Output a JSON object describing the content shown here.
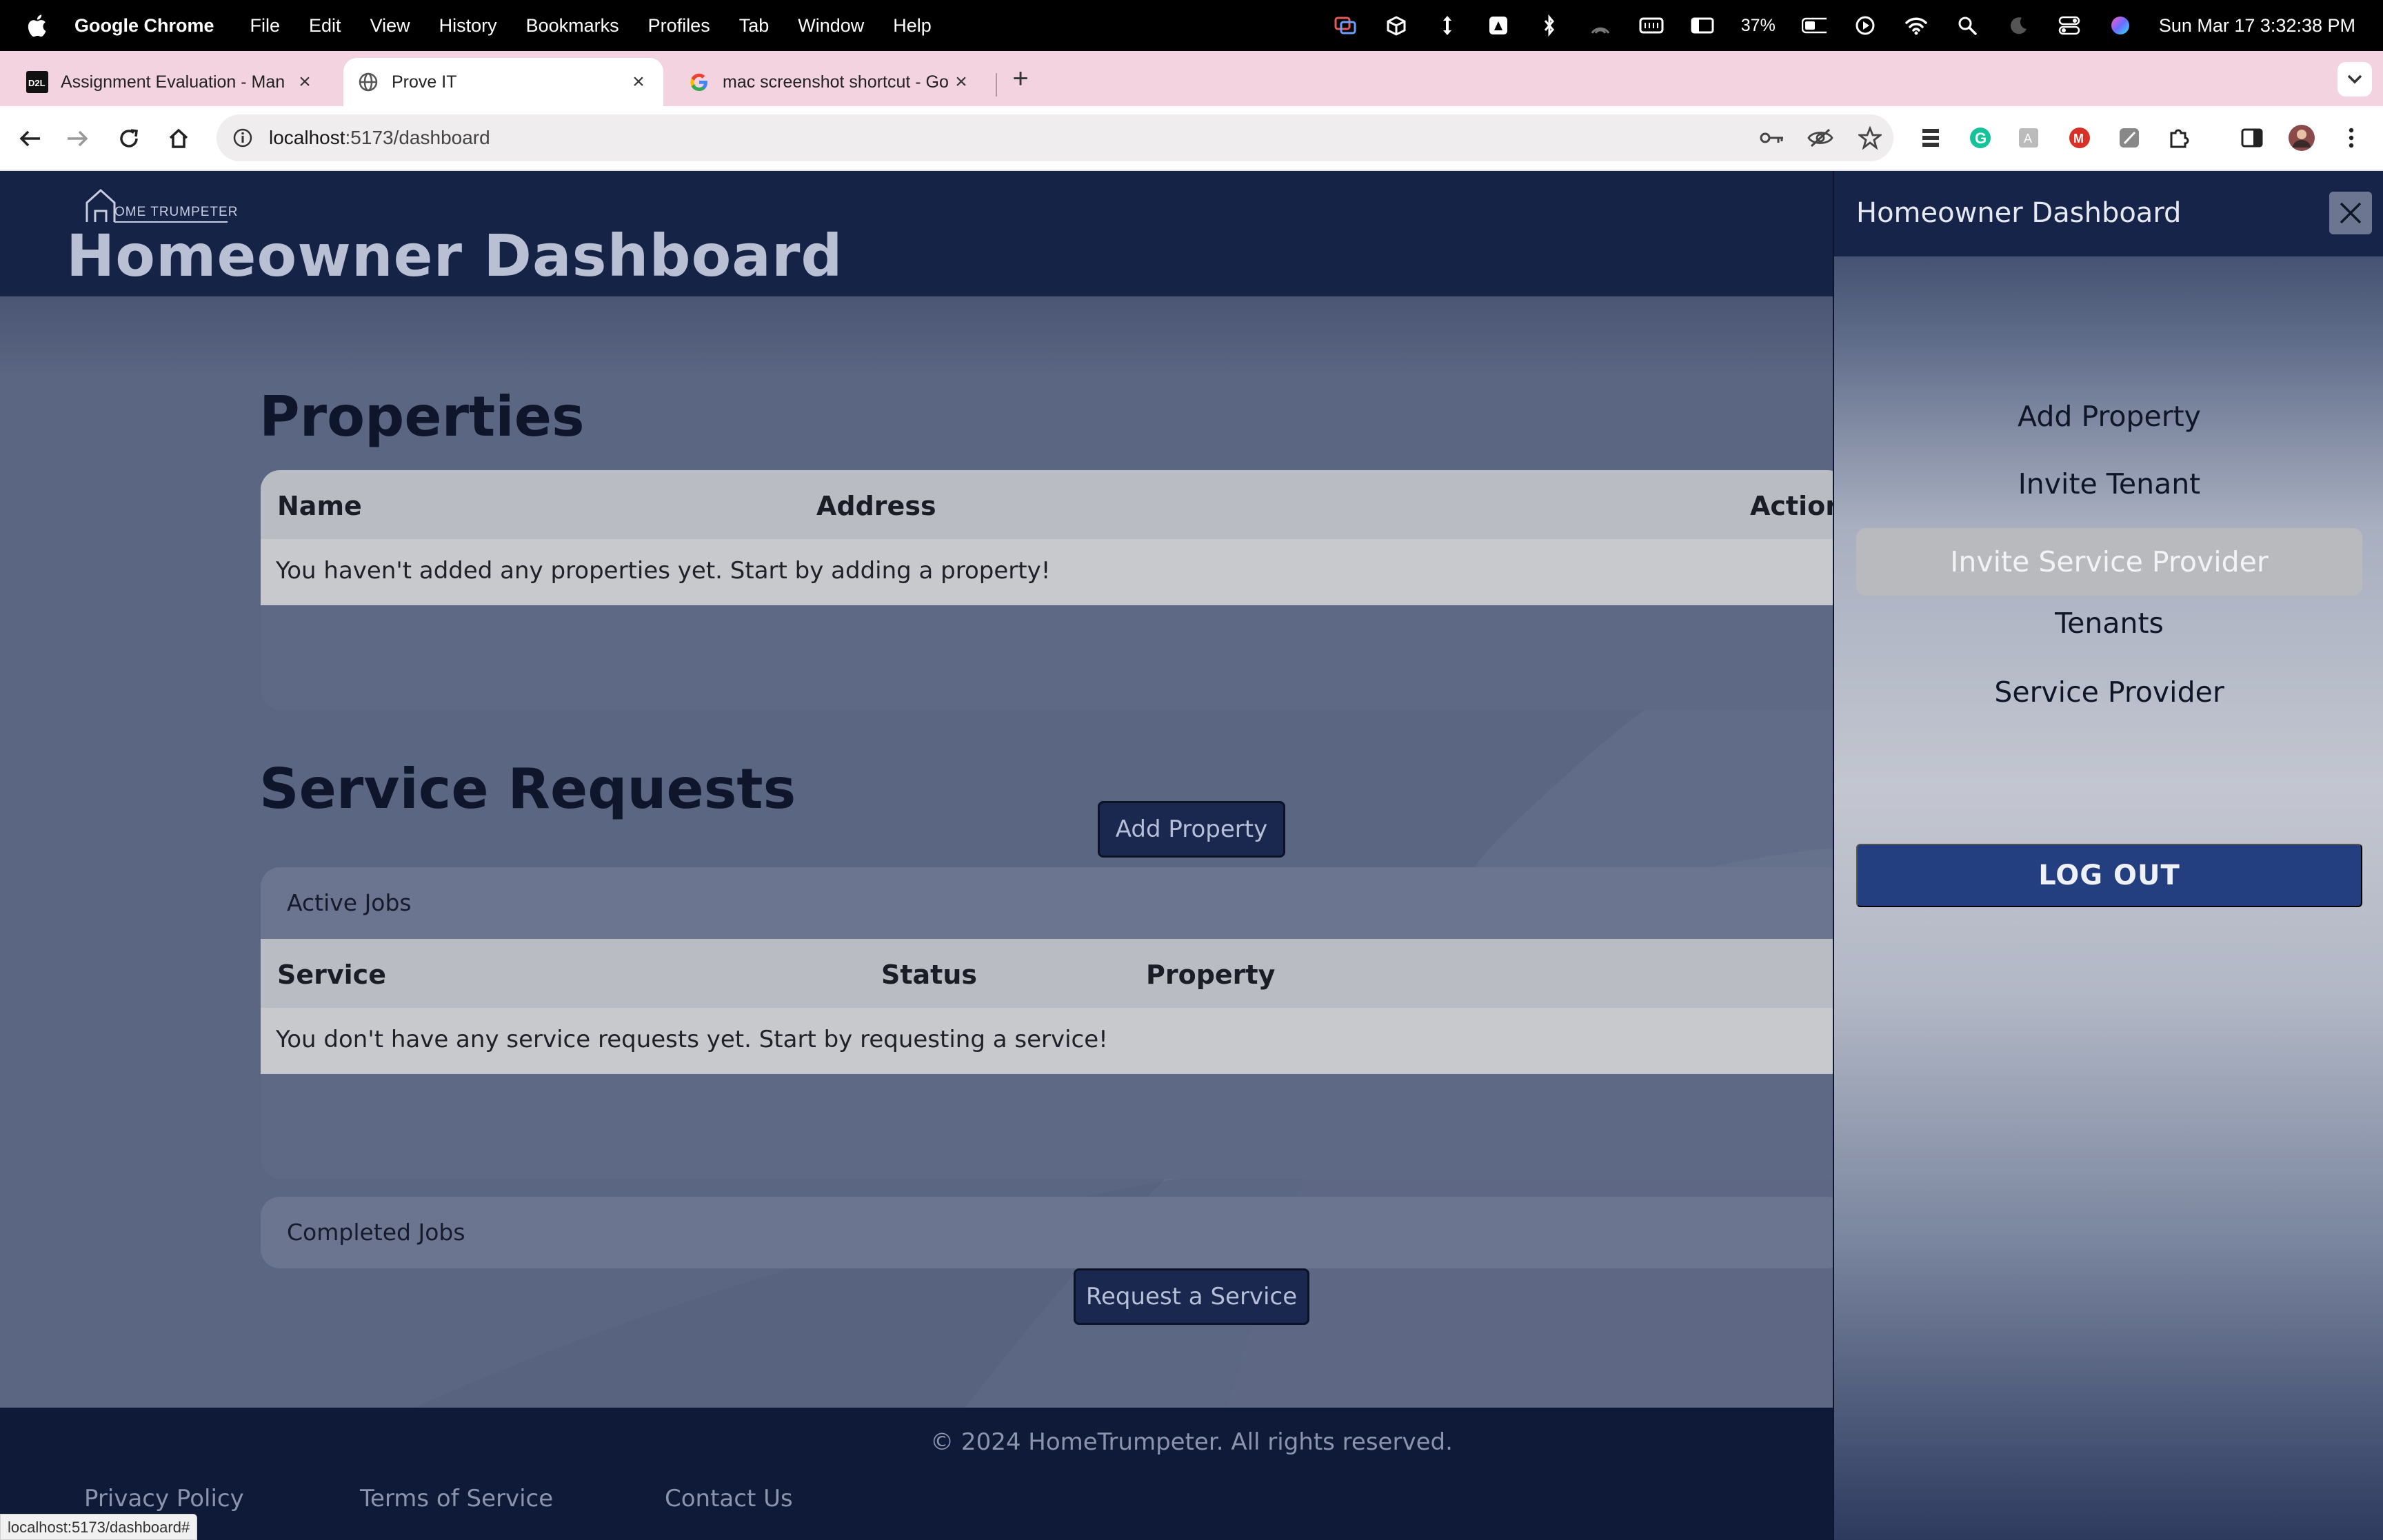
{
  "menubar": {
    "app_name": "Google Chrome",
    "items": [
      "File",
      "Edit",
      "View",
      "History",
      "Bookmarks",
      "Profiles",
      "Tab",
      "Window",
      "Help"
    ],
    "battery_percent": "37%",
    "clock": "Sun Mar 17  3:32:38 PM"
  },
  "browser": {
    "tabs": [
      {
        "title": "Assignment Evaluation - Man",
        "favicon": "d2l-icon",
        "active": false
      },
      {
        "title": "Prove IT",
        "favicon": "globe-icon",
        "active": true
      },
      {
        "title": "mac screenshot shortcut - Go",
        "favicon": "google-icon",
        "active": false
      }
    ],
    "url_host": "localhost",
    "url_path": ":5173/dashboard",
    "status_url": "localhost:5173/dashboard#"
  },
  "header": {
    "logo_text": "OME TRUMPETER",
    "title": "Homeowner Dashboard"
  },
  "properties": {
    "title": "Properties",
    "columns": [
      "Name",
      "Address",
      "Action"
    ],
    "empty_message": "You haven't added any properties yet. Start by adding a property!",
    "add_button": "Add Property"
  },
  "service_requests": {
    "title": "Service Requests",
    "active_jobs_label": "Active Jobs",
    "columns": [
      "Service",
      "Status",
      "Property"
    ],
    "empty_message": "You don't have any service requests yet. Start by requesting a service!",
    "request_button": "Request a Service",
    "completed_jobs_label": "Completed Jobs"
  },
  "footer": {
    "copyright": "© 2024 HomeTrumpeter. All rights reserved.",
    "links": [
      "Privacy Policy",
      "Terms of Service",
      "Contact Us"
    ]
  },
  "drawer": {
    "title": "Homeowner Dashboard",
    "items": [
      "Add Property",
      "Invite Tenant",
      "Invite Service Provider",
      "Tenants",
      "Service Provider"
    ],
    "selected_item": "Invite Service Provider",
    "logout": "LOG OUT"
  },
  "colors": {
    "header_bg": "#152347",
    "page_bg": "#5b6683",
    "drawer_selected": "#b9babd",
    "logout_bg": "#233f80",
    "tab_strip": "#f4d3e0"
  }
}
